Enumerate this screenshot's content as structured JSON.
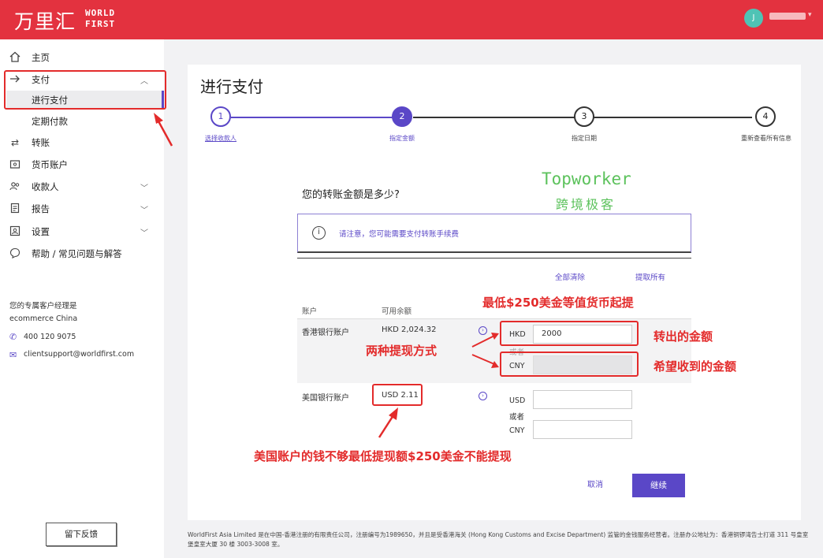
{
  "header": {
    "logo_cn": "万里汇",
    "logo_en_line1": "WORLD",
    "logo_en_line2": "FIRST",
    "avatar_initial": "J"
  },
  "sidebar": {
    "items": [
      {
        "label": "主页",
        "icon": "home-icon"
      },
      {
        "label": "支付",
        "icon": "arrow-right-icon"
      },
      {
        "label": "转账",
        "icon": "transfer-icon"
      },
      {
        "label": "货币账户",
        "icon": "wallet-icon"
      },
      {
        "label": "收款人",
        "icon": "people-icon"
      },
      {
        "label": "报告",
        "icon": "report-icon"
      },
      {
        "label": "设置",
        "icon": "settings-icon"
      },
      {
        "label": "帮助 / 常见问题与解答",
        "icon": "help-icon"
      }
    ],
    "sub_items": [
      {
        "label": "进行支付",
        "active": true
      },
      {
        "label": "定期付款",
        "active": false
      }
    ],
    "manager_title": "您的专属客户经理是",
    "manager_name": "ecommerce China",
    "phone": "400 120 9075",
    "email": "clientsupport@worldfirst.com",
    "feedback_label": "留下反馈"
  },
  "main": {
    "title": "进行支付",
    "steps": [
      {
        "number": "1",
        "label": "选择收款人",
        "state": "done"
      },
      {
        "number": "2",
        "label": "指定金额",
        "state": "active"
      },
      {
        "number": "3",
        "label": "指定日期",
        "state": "pending"
      },
      {
        "number": "4",
        "label": "重新查看所有信息",
        "state": "pending"
      }
    ],
    "question": "您的转账金额是多少?",
    "notice": "请注意，您可能需要支付转账手续费",
    "clear_all": "全部清除",
    "withdraw_all": "提取所有",
    "col_account": "账户",
    "col_balance": "可用余额",
    "accounts": [
      {
        "name": "香港银行账户",
        "balance": "HKD 2,024.32",
        "from_currency": "HKD",
        "from_amount": "2000",
        "or_label": "或者",
        "to_currency": "CNY",
        "to_amount": ""
      },
      {
        "name": "美国银行账户",
        "balance": "USD 2.11",
        "from_currency": "USD",
        "from_amount": "",
        "or_label": "或者",
        "to_currency": "CNY",
        "to_amount": ""
      }
    ],
    "cancel_label": "取消",
    "continue_label": "继续"
  },
  "annotations": {
    "min_amount": "最低$250美金等值货币起提",
    "two_methods": "两种提现方式",
    "transfer_out": "转出的金额",
    "expect_receive": "希望收到的金额",
    "us_insufficient": "美国账户的钱不够最低提现额$250美金不能提现"
  },
  "watermark": {
    "line1": "Topworker",
    "line2": "跨境极客"
  },
  "footer": "WorldFirst Asia Limited 是在中国-香港注册的有限责任公司，注册编号为1989650，并且是受香港海关 (Hong Kong Customs and Excise Department) 监管的金钱服务经营者。注册办公地址为：香港铜锣湾告士打道 311 号皇室堡皇室大厦 30 楼 3003-3008 室。",
  "colors": {
    "brand_red": "#e3323f",
    "accent_purple": "#5a47c7",
    "annotation_red": "#e32b2b",
    "watermark_green": "#5cc25c"
  }
}
